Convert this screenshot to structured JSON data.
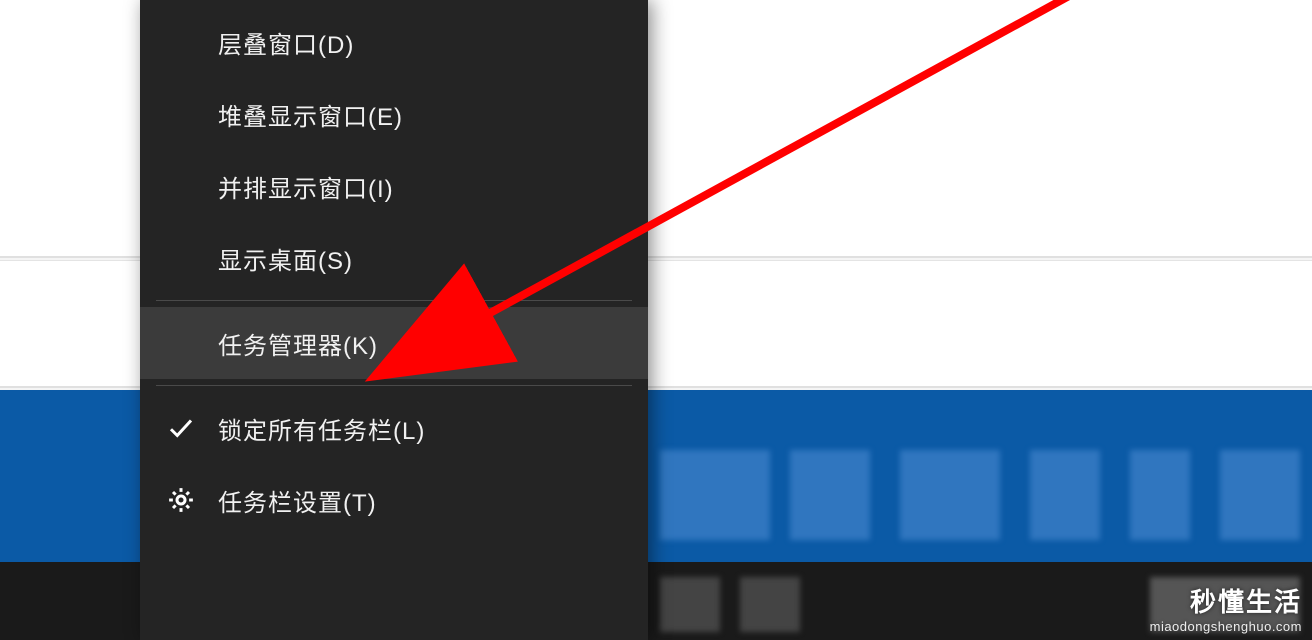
{
  "context_menu": {
    "items": [
      {
        "label": "层叠窗口(D)",
        "icon": null,
        "highlighted": false
      },
      {
        "label": "堆叠显示窗口(E)",
        "icon": null,
        "highlighted": false
      },
      {
        "label": "并排显示窗口(I)",
        "icon": null,
        "highlighted": false
      },
      {
        "label": "显示桌面(S)",
        "icon": null,
        "highlighted": false
      }
    ],
    "items_group2": [
      {
        "label": "任务管理器(K)",
        "icon": null,
        "highlighted": true
      }
    ],
    "items_group3": [
      {
        "label": "锁定所有任务栏(L)",
        "icon": "check",
        "highlighted": false
      },
      {
        "label": "任务栏设置(T)",
        "icon": "gear",
        "highlighted": false
      }
    ]
  },
  "annotation": {
    "arrow_color": "#ff0000",
    "arrow_target": "任务管理器(K)"
  },
  "watermark": {
    "title": "秒懂生活",
    "url": "miaodongshenghuo.com"
  }
}
